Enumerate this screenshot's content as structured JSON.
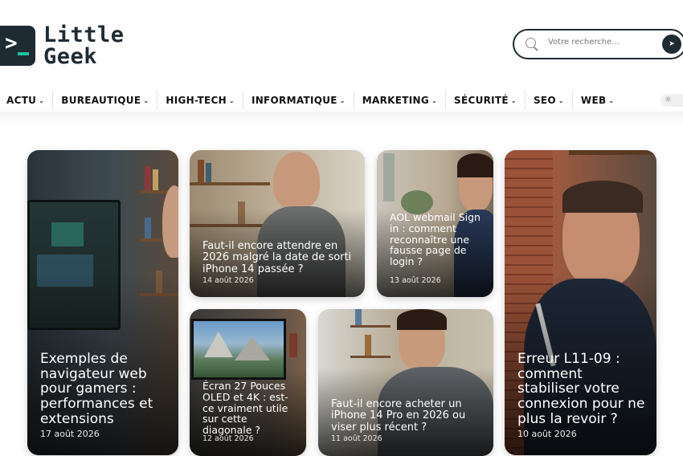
{
  "logo": {
    "line1": "Little",
    "line2": "Geek"
  },
  "search": {
    "placeholder": "Votre recherche..."
  },
  "nav": {
    "items": [
      {
        "label": "ACTU"
      },
      {
        "label": "BUREAUTIQUE"
      },
      {
        "label": "HIGH-TECH"
      },
      {
        "label": "INFORMATIQUE"
      },
      {
        "label": "MARKETING"
      },
      {
        "label": "SÉCURITÉ"
      },
      {
        "label": "SEO"
      },
      {
        "label": "WEB"
      }
    ]
  },
  "articles": [
    {
      "title": "Exemples de navigateur web pour gamers : performances et extensions",
      "date": "17 août 2026"
    },
    {
      "title": "Faut-il encore attendre en 2026 malgré la date de sorti iPhone 14 passée ?",
      "date": "14 août 2026"
    },
    {
      "title": "AOL webmail Sign in : comment reconnaître une fausse page de login ?",
      "date": "13 août 2026"
    },
    {
      "title": "Écran 27 Pouces OLED et 4K : est-ce vraiment utile sur cette diagonale ?",
      "date": "12 août 2026"
    },
    {
      "title": "Faut-il encore acheter un iPhone 14 Pro en 2026 ou viser plus récent ?",
      "date": "11 août 2026"
    },
    {
      "title": "Erreur L11-09 : comment stabiliser votre connexion pour ne plus la revoir ?",
      "date": "10 août 2026"
    }
  ],
  "colors": {
    "brand_dark": "#1f2b33",
    "brand_accent": "#18c3a1"
  }
}
